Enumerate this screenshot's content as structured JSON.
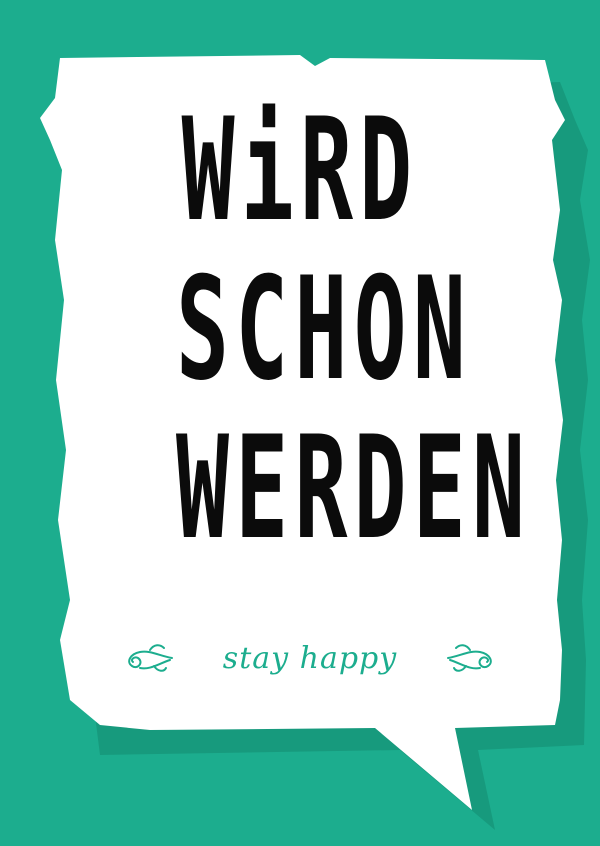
{
  "card": {
    "headline_line1": "WiRD",
    "headline_line2": "SCHON",
    "headline_line3": "WERDEN",
    "tagline": "stay happy"
  },
  "colors": {
    "background": "#1cad8e",
    "shadow": "#179a7d",
    "bubble": "#ffffff",
    "headline": "#0b0b0b",
    "tagline": "#1cad8e"
  },
  "icons": {
    "left_ornament": "flourish-left-icon",
    "right_ornament": "flourish-right-icon"
  }
}
